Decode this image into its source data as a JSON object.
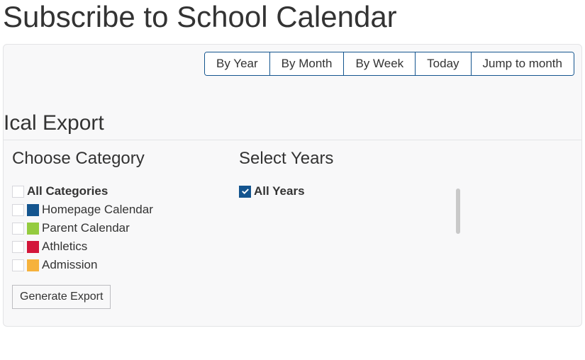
{
  "title": "Subscribe to School Calendar",
  "nav": {
    "by_year": "By Year",
    "by_month": "By Month",
    "by_week": "By Week",
    "today": "Today",
    "jump": "Jump to month"
  },
  "section_title": "Ical Export",
  "category": {
    "heading": "Choose Category",
    "all": "All Categories",
    "items": [
      {
        "label": "Homepage Calendar",
        "color": "midblue"
      },
      {
        "label": "Parent Calendar",
        "color": "green"
      },
      {
        "label": "Athletics",
        "color": "red"
      },
      {
        "label": "Admission",
        "color": "orange"
      }
    ]
  },
  "years": {
    "heading": "Select Years",
    "all": "All Years"
  },
  "generate": "Generate Export"
}
